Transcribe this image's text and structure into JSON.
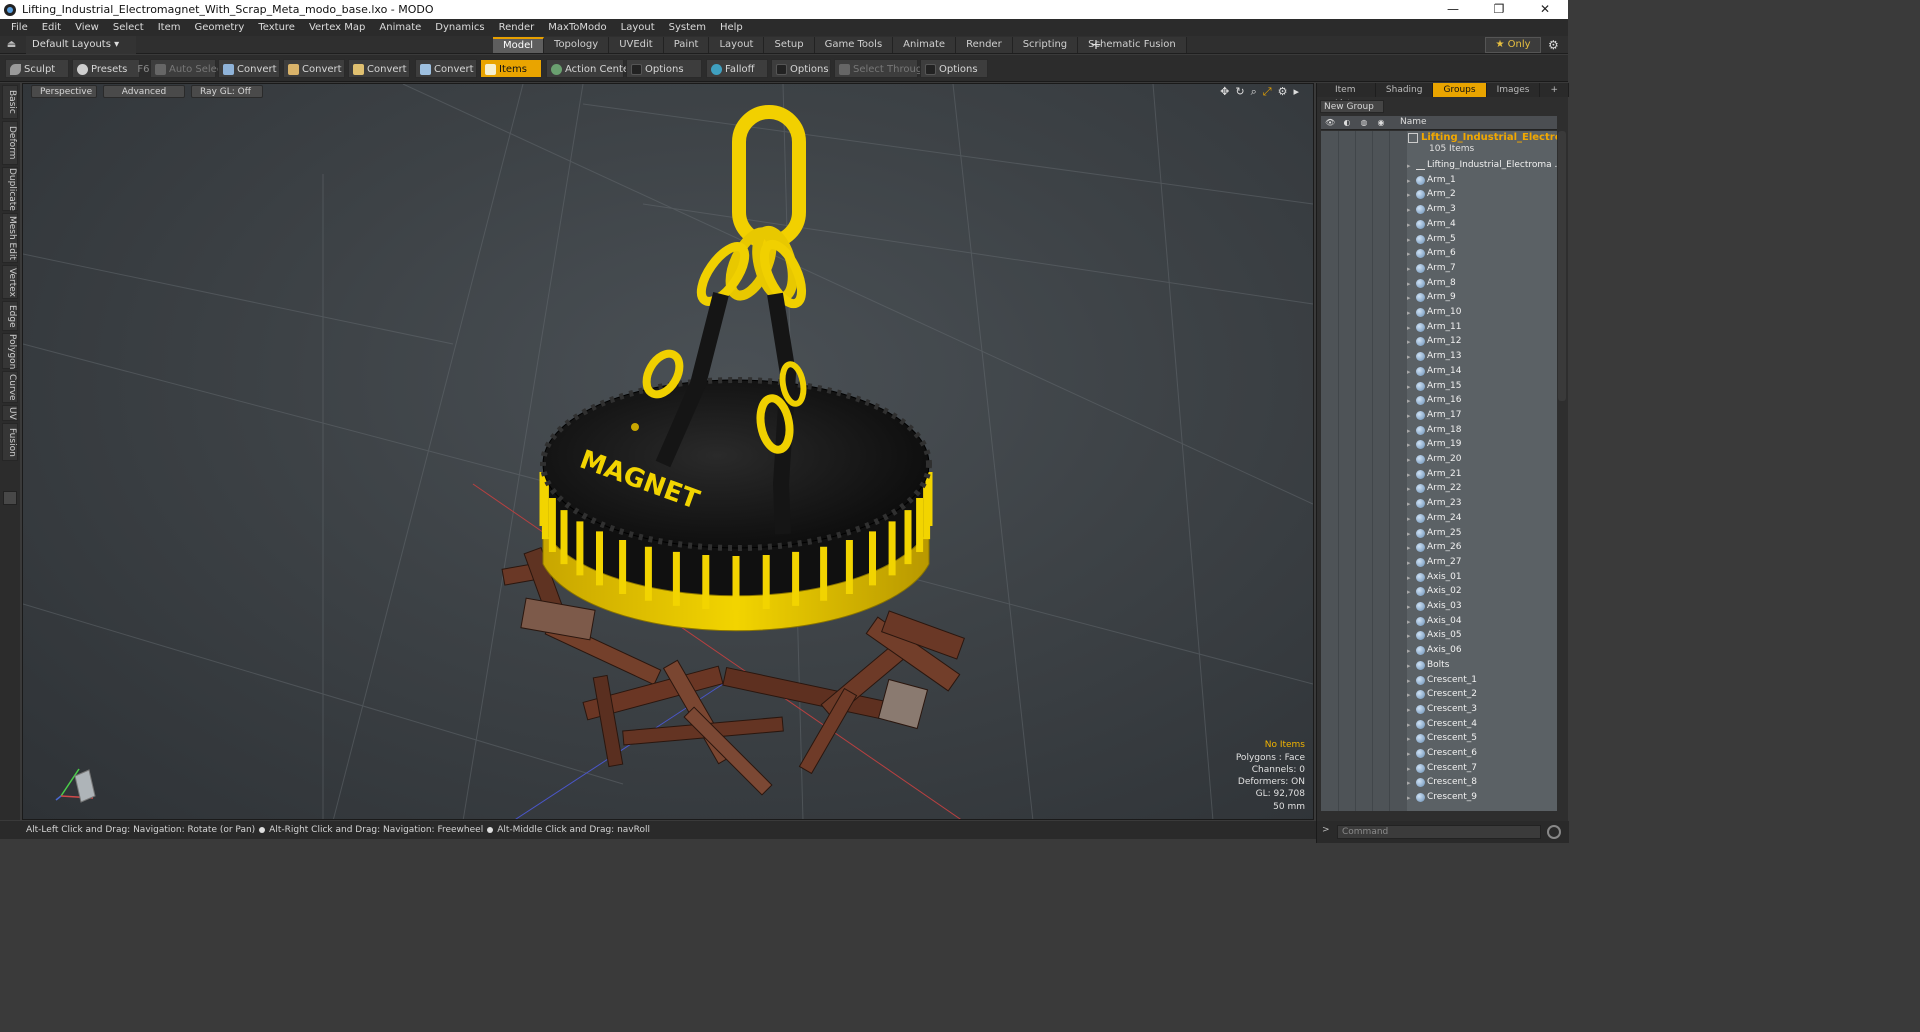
{
  "window": {
    "title": "Lifting_Industrial_Electromagnet_With_Scrap_Meta_modo_base.lxo - MODO",
    "controls": [
      "—",
      "❐",
      "✕"
    ]
  },
  "menu": [
    "File",
    "Edit",
    "View",
    "Select",
    "Item",
    "Geometry",
    "Texture",
    "Vertex Map",
    "Animate",
    "Dynamics",
    "Render",
    "MaxToModo",
    "Layout",
    "System",
    "Help"
  ],
  "layout_selector": "Default Layouts ▾",
  "tabs": [
    "Model",
    "Topology",
    "UVEdit",
    "Paint",
    "Layout",
    "Setup",
    "Game Tools",
    "Animate",
    "Render",
    "Scripting",
    "Schematic Fusion"
  ],
  "active_tab": "Model",
  "only_label": "★  Only",
  "toolbar": {
    "sculpt": "Sculpt",
    "presets": "Presets",
    "presets_key": "F6",
    "auto_select": "Auto Select",
    "convert1": "Convert",
    "convert2": "Convert",
    "convert3": "Convert",
    "convert4": "Convert",
    "items": "Items",
    "action_center": "Action Center",
    "options1": "Options",
    "falloff": "Falloff",
    "options2": "Options",
    "select_through": "Select Through",
    "options3": "Options"
  },
  "left_tabs": [
    "Basic",
    "Deform",
    "Duplicate",
    "Mesh Edit",
    "Vertex",
    "Edge",
    "Polygon",
    "Curve",
    "UV",
    "Fusion"
  ],
  "viewport": {
    "perspective": "Perspective",
    "advanced": "Advanced",
    "raygl": "Ray GL: Off",
    "label_text": "MAGNET",
    "info": {
      "no_items": "No Items",
      "polygons": "Polygons : Face",
      "channels": "Channels: 0",
      "deformers": "Deformers: ON",
      "gl": "GL: 92,708",
      "size": "50 mm"
    }
  },
  "status": {
    "part1": "Alt-Left Click and Drag: Navigation: Rotate (or Pan)",
    "part2": "Alt-Right Click and Drag: Navigation: Freewheel",
    "part3": "Alt-Middle Click and Drag: navRoll"
  },
  "right_panel": {
    "tabs": [
      "Item List",
      "Shading",
      "Groups",
      "Images",
      "+"
    ],
    "active_tab": "Groups",
    "new_group": "New Group",
    "column_name": "Name",
    "group_name": "Lifting_Industrial_Electro ...",
    "group_count": "105 Items",
    "items": [
      "Lifting_Industrial_Electroma ...",
      "Arm_1",
      "Arm_2",
      "Arm_3",
      "Arm_4",
      "Arm_5",
      "Arm_6",
      "Arm_7",
      "Arm_8",
      "Arm_9",
      "Arm_10",
      "Arm_11",
      "Arm_12",
      "Arm_13",
      "Arm_14",
      "Arm_15",
      "Arm_16",
      "Arm_17",
      "Arm_18",
      "Arm_19",
      "Arm_20",
      "Arm_21",
      "Arm_22",
      "Arm_23",
      "Arm_24",
      "Arm_25",
      "Arm_26",
      "Arm_27",
      "Axis_01",
      "Axis_02",
      "Axis_03",
      "Axis_04",
      "Axis_05",
      "Axis_06",
      "Bolts",
      "Crescent_1",
      "Crescent_2",
      "Crescent_3",
      "Crescent_4",
      "Crescent_5",
      "Crescent_6",
      "Crescent_7",
      "Crescent_8",
      "Crescent_9"
    ],
    "command_placeholder": "Command"
  },
  "colors": {
    "accent": "#e9a400",
    "magnet_yellow": "#f0d000",
    "magnet_black": "#141414",
    "rust": "#6b3a28"
  }
}
